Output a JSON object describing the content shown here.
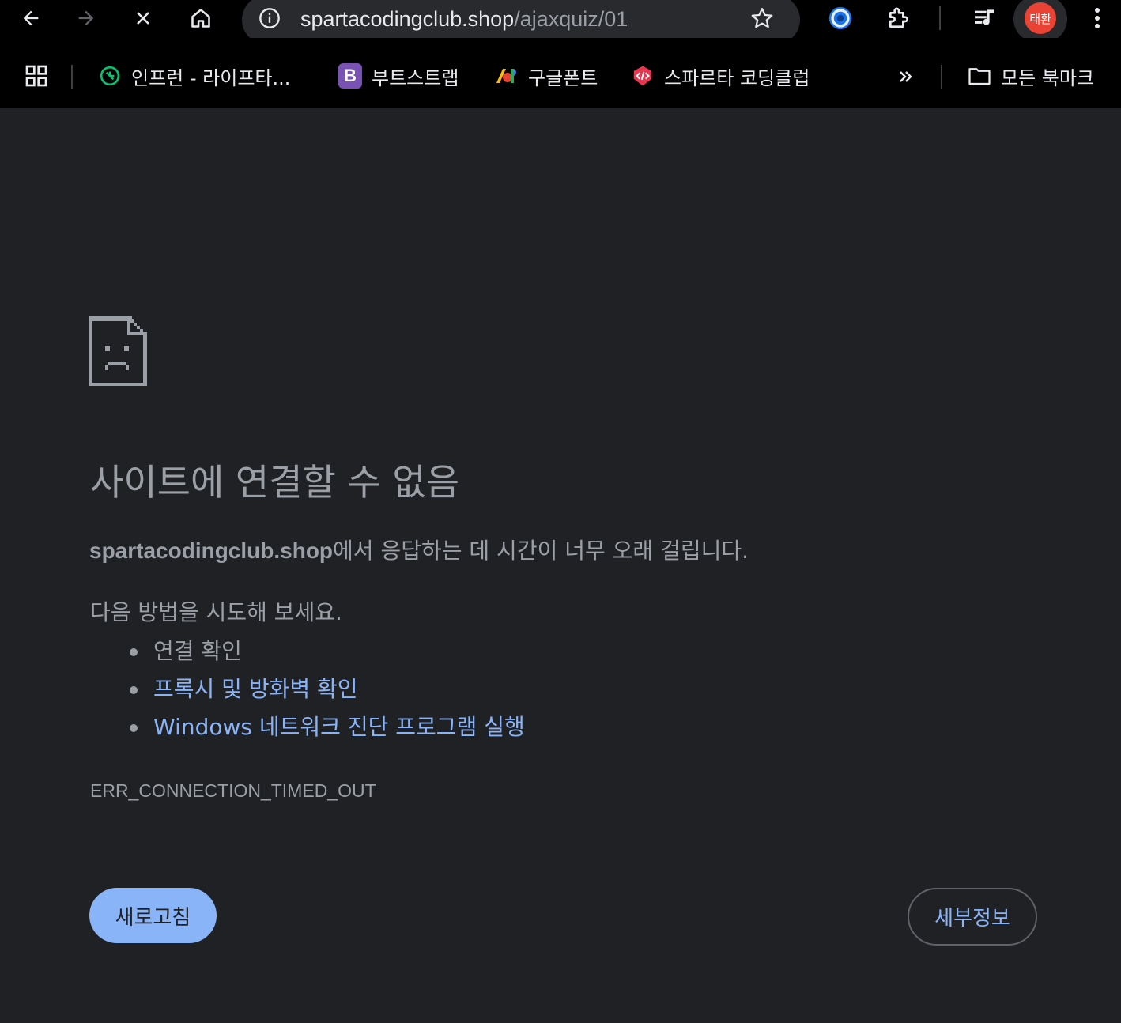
{
  "browser": {
    "url_domain": "spartacodingclub.shop",
    "url_path": "/ajaxquiz/01",
    "profile_initials": "태환"
  },
  "bookmarks": {
    "items": [
      {
        "label": "인프런 - 라이프타..."
      },
      {
        "label": "부트스트랩",
        "favicon_text": "B"
      },
      {
        "label": "구글폰트"
      },
      {
        "label": "스파르타 코딩클럽"
      }
    ],
    "all_bookmarks_label": "모든 북마크"
  },
  "error": {
    "title": "사이트에 연결할 수 없음",
    "site": "spartacodingclub.shop",
    "description_suffix": "에서 응답하는 데 시간이 너무 오래 걸립니다.",
    "try_heading": "다음 방법을 시도해 보세요.",
    "suggestions": [
      {
        "label": "연결 확인"
      },
      {
        "label": "프록시 및 방화벽 확인"
      },
      {
        "label": "Windows 네트워크 진단 프로그램 실행"
      }
    ],
    "error_code": "ERR_CONNECTION_TIMED_OUT",
    "reload_label": "새로고침",
    "details_label": "세부정보"
  },
  "colors": {
    "page_bg": "#202124",
    "text": "#9aa0a6",
    "link": "#8ab4f8",
    "toolbar_bg": "#000000",
    "avatar": "#ea4335"
  }
}
